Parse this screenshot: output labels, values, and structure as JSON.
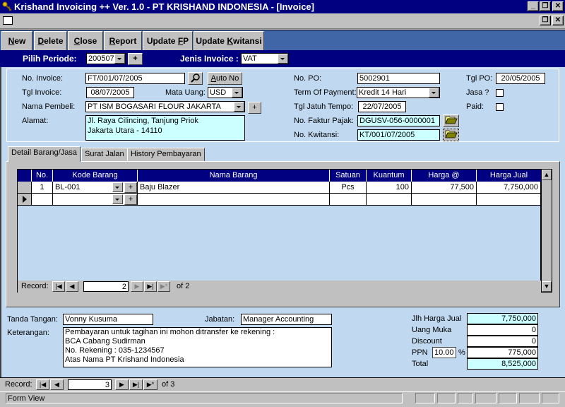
{
  "window": {
    "title": "Krishand Invoicing ++ Ver. 1.0 - PT KRISHAND INDONESIA - [Invoice]",
    "minimize": "_",
    "restore": "❐",
    "close": "✕"
  },
  "toolbar": {
    "buttons": [
      {
        "label": "New",
        "underline": "N",
        "rest": "ew"
      },
      {
        "label": "Delete",
        "underline": "D",
        "rest": "elete"
      },
      {
        "label": "Close",
        "underline": "C",
        "rest": "lose"
      },
      {
        "label": "Report",
        "underline": "R",
        "rest": "eport"
      },
      {
        "label": "Update FP",
        "pre": "Update ",
        "underline": "F",
        "rest": "P"
      },
      {
        "label": "Update Kwitansi",
        "pre": "Update ",
        "underline": "K",
        "rest": "witansi"
      }
    ]
  },
  "period": {
    "label": "Pilih Periode:",
    "value": "200507",
    "add": "+",
    "invoice_type_label": "Jenis Invoice :",
    "invoice_type_value": "VAT"
  },
  "header": {
    "no_invoice_label": "No. Invoice:",
    "no_invoice": "FT/001/07/2005",
    "auto_no": "Auto No",
    "tgl_invoice_label": "Tgl Invoice:",
    "tgl_invoice": "08/07/2005",
    "mata_uang_label": "Mata Uang:",
    "mata_uang": "USD",
    "nama_pembeli_label": "Nama Pembeli:",
    "nama_pembeli": "PT ISM BOGASARI FLOUR JAKARTA",
    "add": "+",
    "alamat_label": "Alamat:",
    "alamat_line1": "Jl. Raya Cilincing, Tanjung Priok",
    "alamat_line2": "Jakarta Utara - 14110",
    "no_po_label": "No. PO:",
    "no_po": "5002901",
    "tgl_po_label": "Tgl PO:",
    "tgl_po": "20/05/2005",
    "term_label": "Term Of Payment:",
    "term": "Kredit 14 Hari",
    "jasa_label": "Jasa ?",
    "jasa": false,
    "jatuh_tempo_label": "Tgl Jatuh Tempo:",
    "jatuh_tempo": "22/07/2005",
    "paid_label": "Paid:",
    "paid": false,
    "faktur_label": "No. Faktur Pajak:",
    "faktur": "DGUSV-056-0000001",
    "kwitansi_label": "No. Kwitansi:",
    "kwitansi": "KT/001/07/2005"
  },
  "tabs": [
    {
      "label": "Detail Barang/Jasa",
      "active": true
    },
    {
      "label": "Surat Jalan",
      "active": false
    },
    {
      "label": "History Pembayaran",
      "active": false
    }
  ],
  "grid": {
    "columns": [
      "No.",
      "Kode Barang",
      "Nama Barang",
      "Satuan",
      "Kuantum",
      "Harga @",
      "Harga Jual"
    ],
    "rows": [
      {
        "no": "1",
        "kode": "BL-001",
        "nama": "Baju Blazer",
        "satuan": "Pcs",
        "kuantum": "100",
        "harga": "77,500",
        "jual": "7,750,000"
      }
    ],
    "add": "+",
    "record_label": "Record:",
    "record_current": "2",
    "record_of": "of  2"
  },
  "footer": {
    "tanda_tangan_label": "Tanda Tangan:",
    "tanda_tangan": "Vonny Kusuma",
    "jabatan_label": "Jabatan:",
    "jabatan": "Manager Accounting",
    "keterangan_label": "Keterangan:",
    "keterangan": [
      "Pembayaran untuk tagihan ini mohon ditransfer ke rekening :",
      "BCA Cabang Sudirman",
      "No. Rekening : 035-1234567",
      "Atas Nama PT Krishand Indonesia"
    ],
    "jlh_label": "Jlh Harga Jual",
    "jlh": "7,750,000",
    "uang_muka_label": "Uang Muka",
    "uang_muka": "0",
    "discount_label": "Discount",
    "discount": "0",
    "ppn_label": "PPN",
    "ppn_rate": "10.00",
    "ppn_pct": "%",
    "ppn": "775,000",
    "total_label": "Total",
    "total": "8,525,000"
  },
  "form_nav": {
    "record_label": "Record:",
    "record_current": "3",
    "record_of": "of  3"
  },
  "status": {
    "text": "Form View"
  }
}
